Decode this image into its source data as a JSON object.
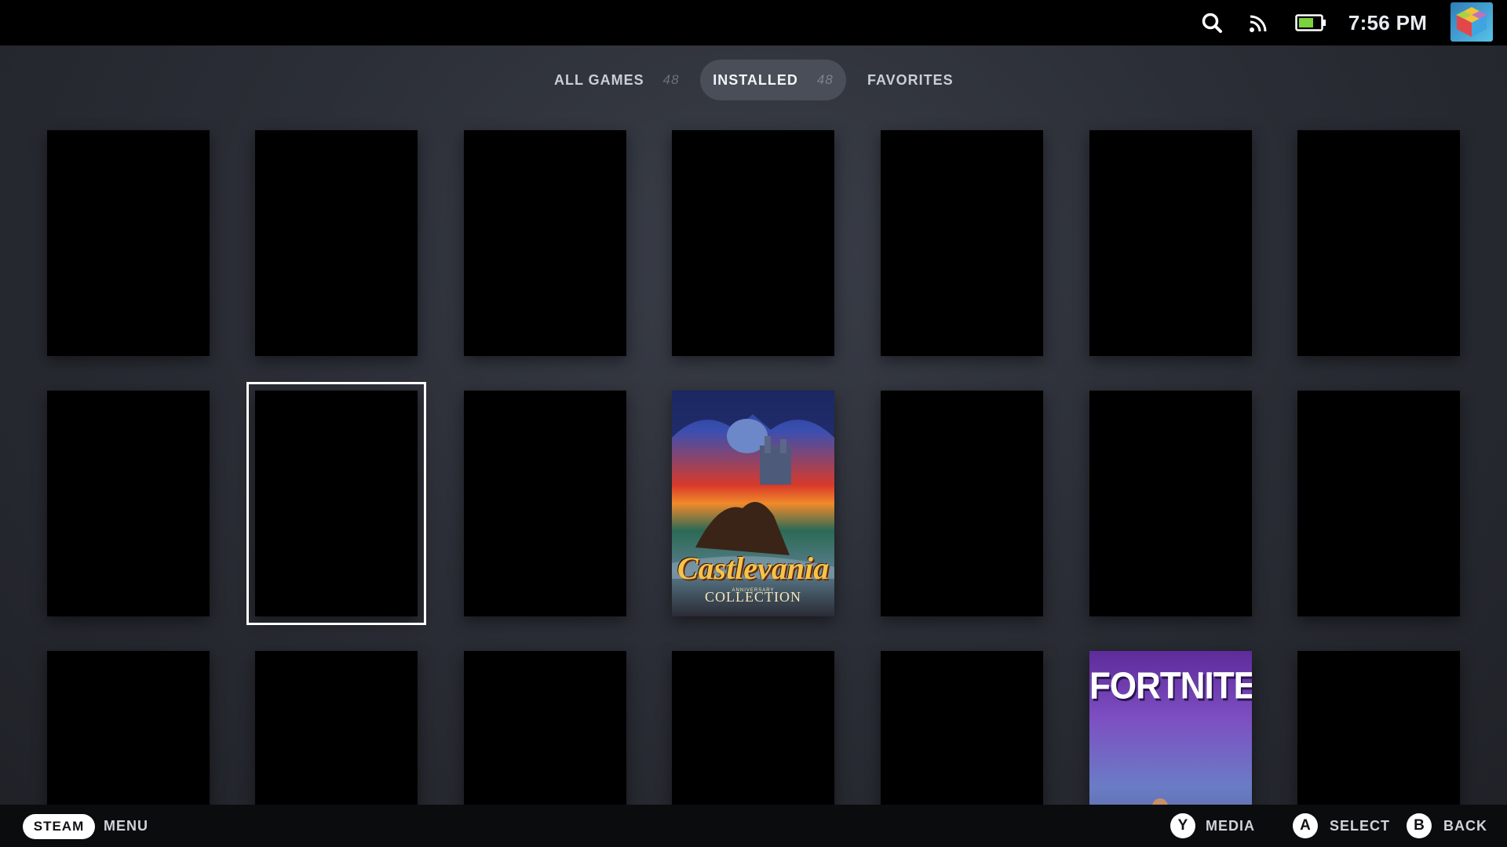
{
  "status_bar": {
    "time": "7:56 PM",
    "icons": [
      "search-icon",
      "rss-icon",
      "battery-icon"
    ],
    "battery_color": "#7ad23c"
  },
  "tabs": [
    {
      "label": "ALL GAMES",
      "count": "48",
      "selected": false
    },
    {
      "label": "INSTALLED",
      "count": "48",
      "selected": true
    },
    {
      "label": "FAVORITES",
      "selected": false
    }
  ],
  "games": {
    "castlevania": {
      "title": "Castlevania",
      "subtitle": "ANNIVERSARY",
      "edition": "COLLECTION"
    },
    "fortnite": {
      "title": "FORTNITE"
    }
  },
  "bottom_bar": {
    "steam_label": "STEAM",
    "menu_label": "MENU",
    "y_glyph": "Y",
    "media_label": "MEDIA",
    "a_glyph": "A",
    "select_label": "SELECT",
    "b_glyph": "B",
    "back_label": "BACK"
  },
  "colors": {
    "accent_white": "#ffffff",
    "selected_tab_bg": "#4a4e58",
    "background": "#2b2e36"
  }
}
